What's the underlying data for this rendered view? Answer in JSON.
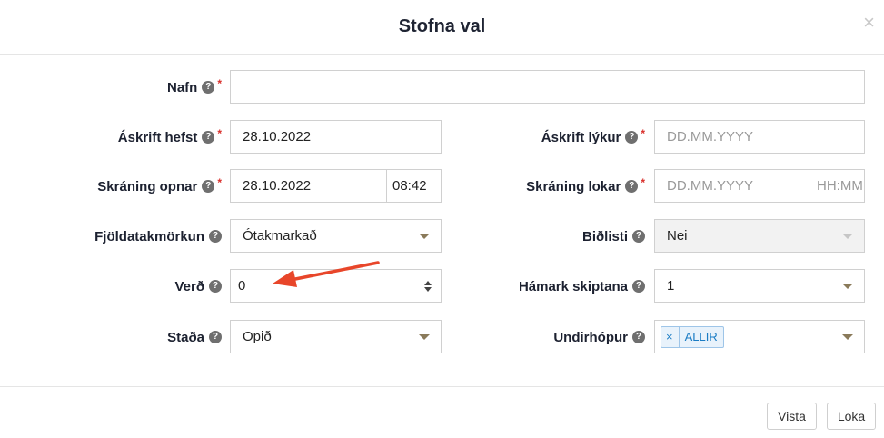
{
  "dialog": {
    "title": "Stofna val",
    "close_glyph": "×"
  },
  "help_glyph": "?",
  "required_mark": "*",
  "form": {
    "nafn": {
      "label": "Nafn",
      "value": ""
    },
    "askrift_hefst": {
      "label": "Áskrift hefst",
      "value": "28.10.2022"
    },
    "askrift_lykur": {
      "label": "Áskrift lýkur",
      "placeholder": "DD.MM.YYYY"
    },
    "skraning_opnar": {
      "label": "Skráning opnar",
      "date": "28.10.2022",
      "time": "08:42"
    },
    "skraning_lokar": {
      "label": "Skráning lokar",
      "date_placeholder": "DD.MM.YYYY",
      "time_placeholder": "HH:MM"
    },
    "fjoldatakmorkun": {
      "label": "Fjöldatakmörkun",
      "value": "Ótakmarkað"
    },
    "bidlisti": {
      "label": "Biðlisti",
      "value": "Nei"
    },
    "verd": {
      "label": "Verð",
      "value": "0"
    },
    "hamark_skiptana": {
      "label": "Hámark skiptana",
      "value": "1"
    },
    "stada": {
      "label": "Staða",
      "value": "Opið"
    },
    "undirhopur": {
      "label": "Undirhópur",
      "tags": [
        "ALLIR"
      ],
      "tag_remove_glyph": "×"
    }
  },
  "footer": {
    "save_label": "Vista",
    "close_label": "Loka"
  },
  "colors": {
    "required": "#d9302c",
    "annotation_arrow": "#e8462a",
    "tag_text": "#1a7cc4"
  }
}
